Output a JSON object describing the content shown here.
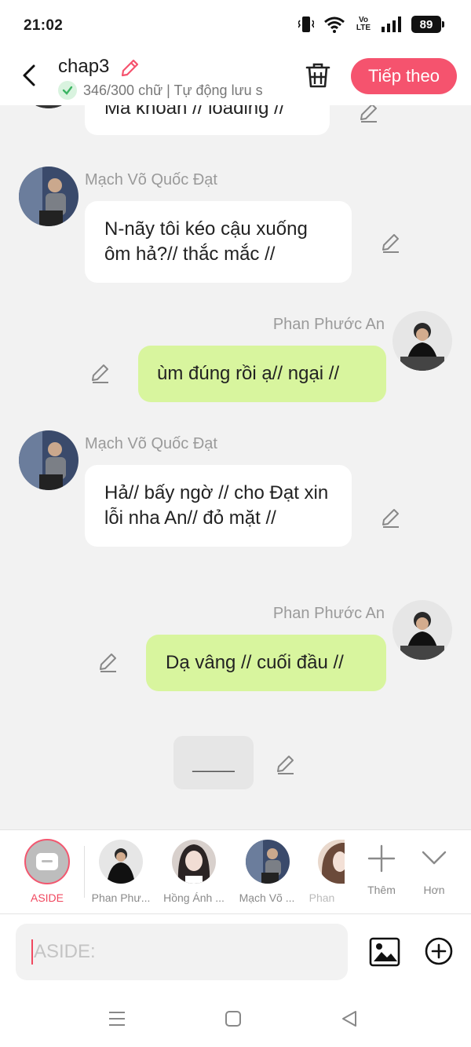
{
  "status_bar": {
    "time": "21:02",
    "network_label": "Vo LTE",
    "battery": "89"
  },
  "header": {
    "title": "chap3",
    "save_status": "346/300 chữ | Tự động lưu s",
    "next_label": "Tiếp theo"
  },
  "chat": {
    "partial_message": "Mã khoản // loading //",
    "messages": [
      {
        "sender": "Mạch Võ Quốc Đạt",
        "text": "N-nãy tôi kéo cậu xuống ôm hả?// thắc mắc //"
      },
      {
        "sender": "Phan Phước An",
        "text": "ùm đúng rồi ạ// ngại //"
      },
      {
        "sender": "Mạch Võ Quốc Đạt",
        "text": "Hả// bấy ngờ // cho Đạt xin lỗi nha An// đỏ mặt //"
      },
      {
        "sender": "Phan Phước An",
        "text": "Dạ vâng // cuối đầu //"
      }
    ],
    "aside_text": "____"
  },
  "character_bar": {
    "aside_label": "ASIDE",
    "characters": [
      {
        "name": "Phan Phư..."
      },
      {
        "name": "Hồng Ánh ..."
      },
      {
        "name": "Mạch Võ ..."
      },
      {
        "name": "Phan"
      }
    ],
    "add_label": "Thêm",
    "more_label": "Hơn"
  },
  "composer": {
    "placeholder": "ASIDE:"
  },
  "colors": {
    "accent": "#f5536e",
    "outgoing_bubble": "#d8f59e",
    "incoming_bubble": "#ffffff",
    "background": "#f2f2f2"
  }
}
